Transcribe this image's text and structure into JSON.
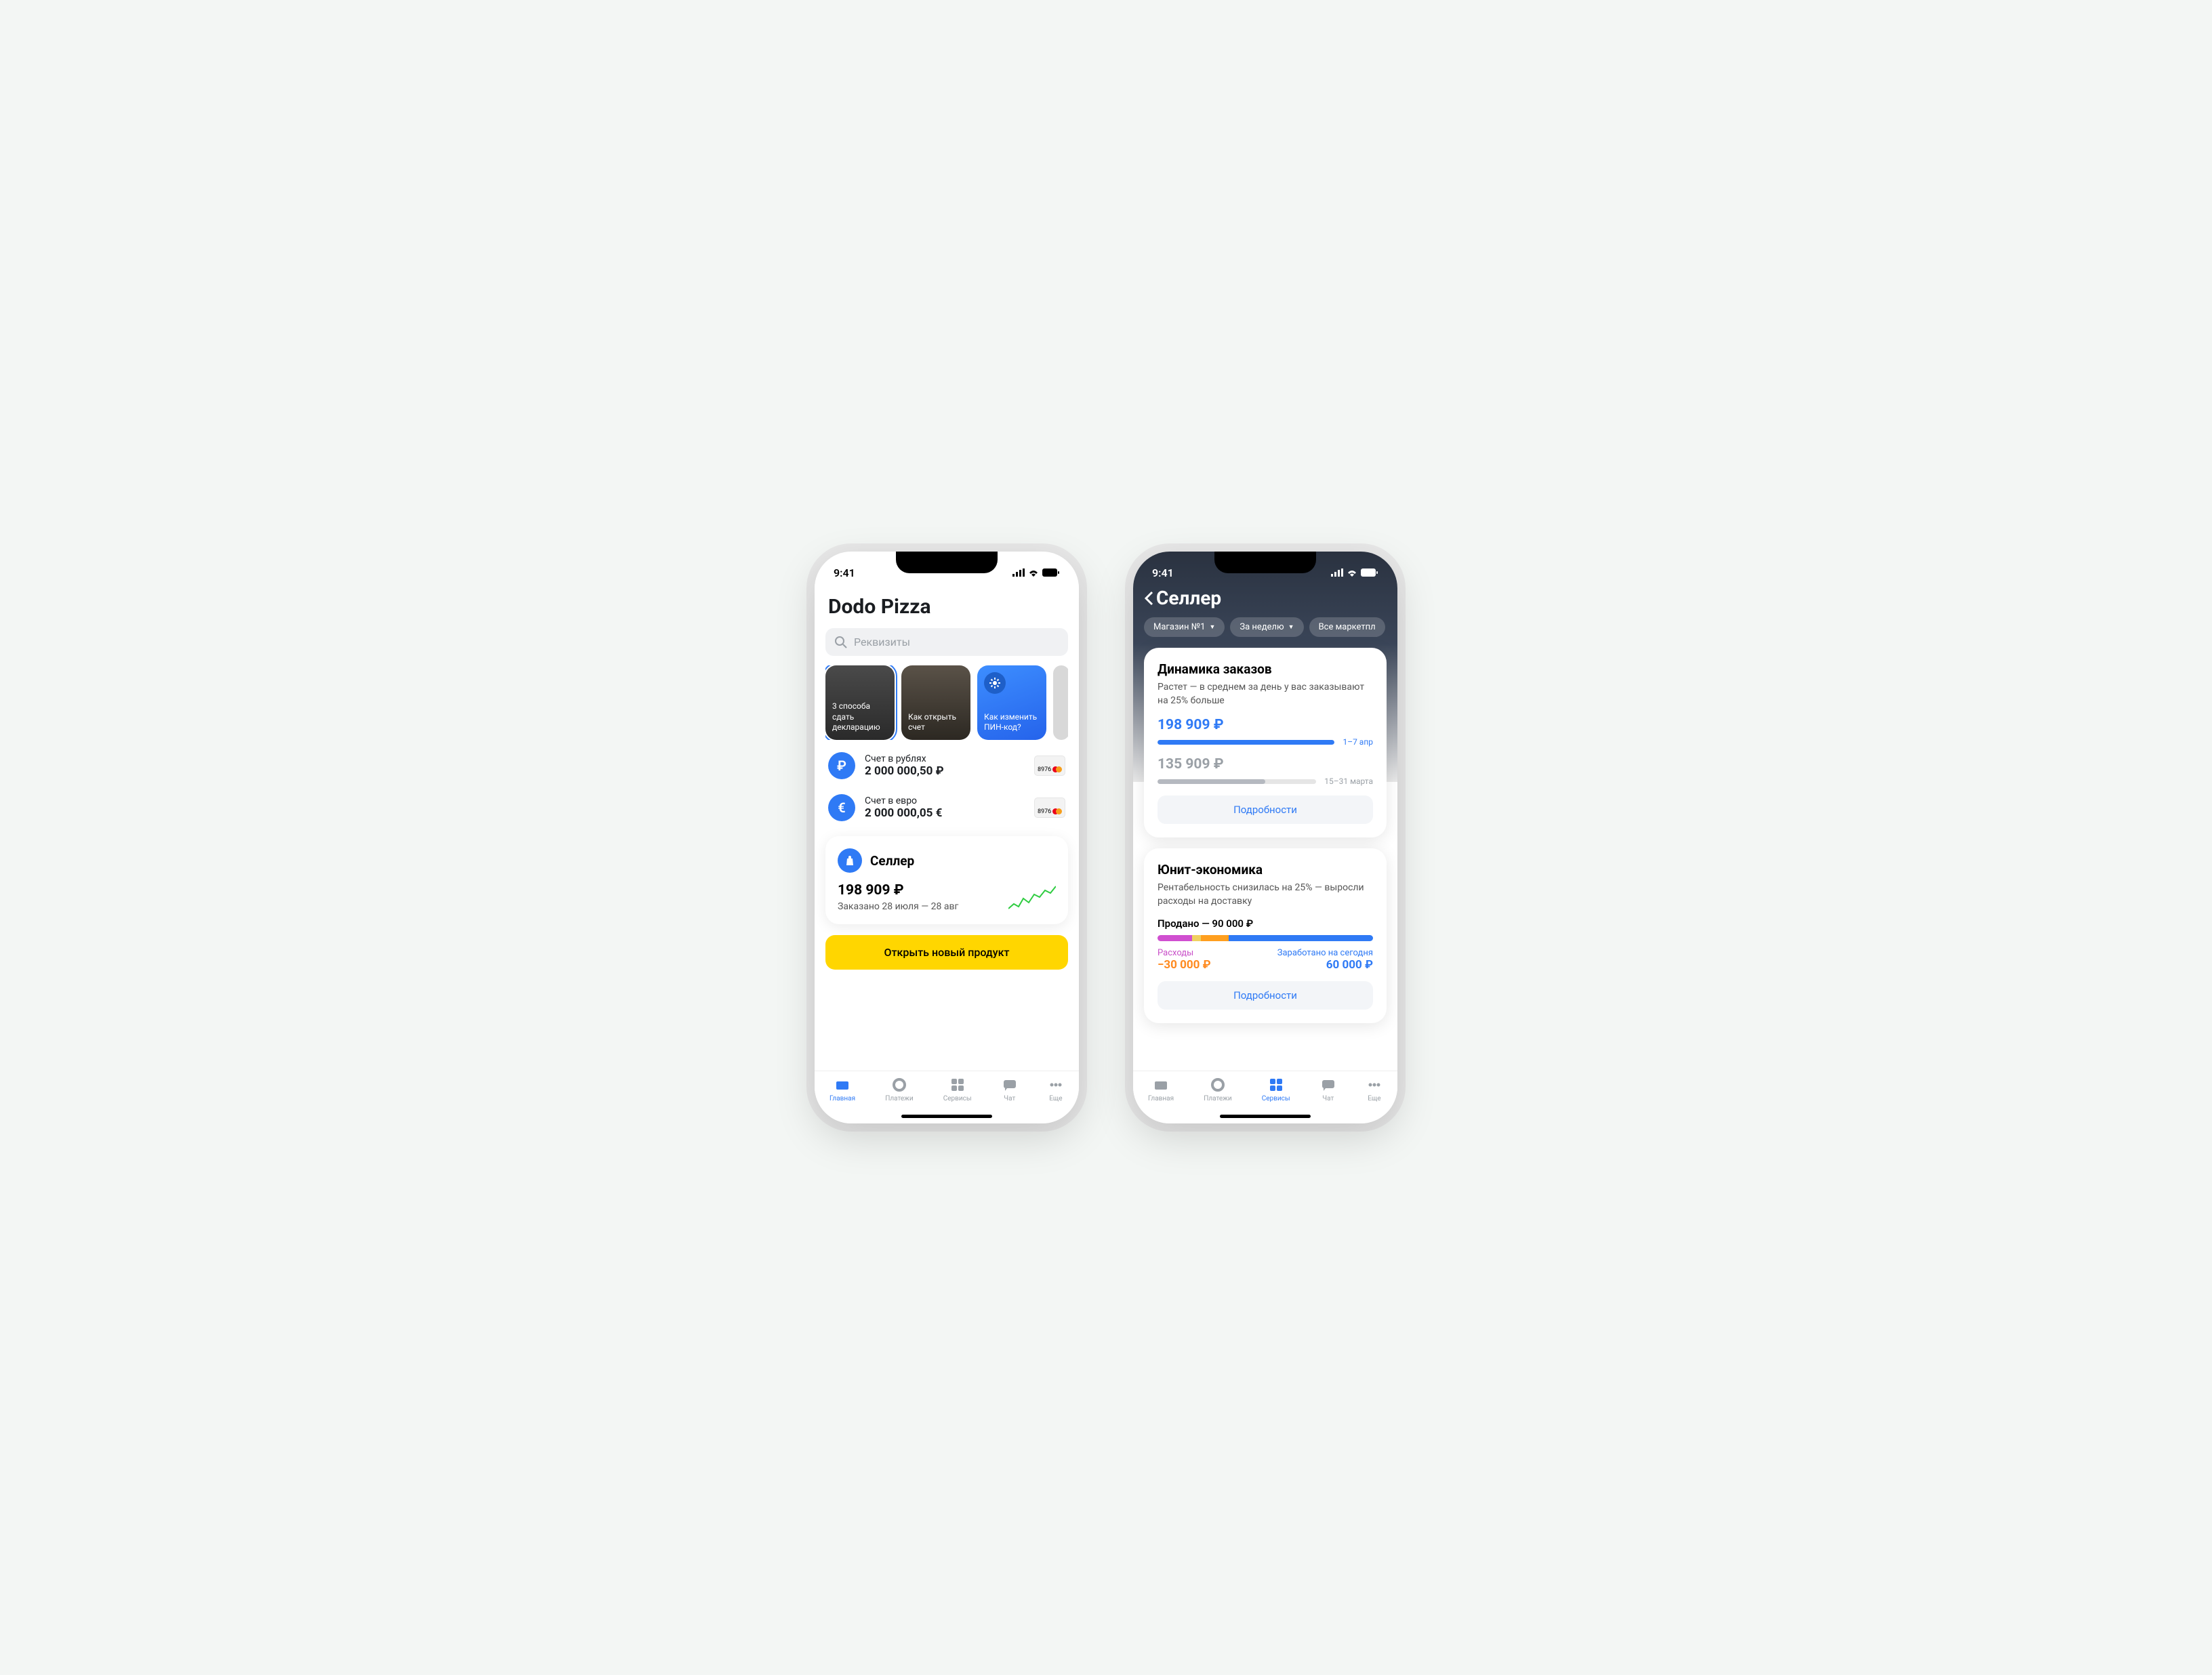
{
  "status": {
    "time": "9:41"
  },
  "phone1": {
    "title": "Dodo Pizza",
    "search_placeholder": "Реквизиты",
    "stories": [
      {
        "text": "3 способа сдать декларацию"
      },
      {
        "text": "Как открыть счет"
      },
      {
        "text": "Как изменить ПИН-код?"
      }
    ],
    "accounts": [
      {
        "label": "Счет в рублях",
        "balance": "2 000 000,50 ₽",
        "card_last4": "8976",
        "symbol": "₽"
      },
      {
        "label": "Счет в евро",
        "balance": "2 000 000,05 €",
        "card_last4": "8976",
        "symbol": "€"
      }
    ],
    "seller": {
      "title": "Селлер",
      "amount": "198 909 ₽",
      "subtitle": "Заказано 28 июля — 28 авг"
    },
    "open_button": "Открыть новый продукт"
  },
  "phone2": {
    "title": "Селлер",
    "chips": [
      "Магазин №1",
      "За неделю",
      "Все маркетпл"
    ],
    "orders": {
      "title": "Динамика заказов",
      "desc": "Растет — в среднем за день у вас заказывают на 25% больше",
      "current_val": "198 909 ₽",
      "current_period": "1–7 апр",
      "prev_val": "135 909 ₽",
      "prev_period": "15–31 марта",
      "details": "Подробности"
    },
    "unit": {
      "title": "Юнит-экономика",
      "desc": "Рентабельность снизилась на 25% — выросли расходы на доставку",
      "sold_label": "Продано — 90 000 ₽",
      "expenses_label": "Расходы",
      "expenses_val": "−30 000 ₽",
      "earned_label": "Заработано на сегодня",
      "earned_val": "60 000 ₽",
      "details": "Подробности"
    }
  },
  "tabs": {
    "home": "Главная",
    "payments": "Платежи",
    "services": "Сервисы",
    "chat": "Чат",
    "more": "Еще"
  },
  "chart_data": [
    {
      "type": "bar",
      "title": "Динамика заказов",
      "categories": [
        "15–31 марта",
        "1–7 апр"
      ],
      "values": [
        135909,
        198909
      ],
      "ylabel": "₽"
    },
    {
      "type": "bar",
      "title": "Юнит-экономика",
      "categories": [
        "Расходы",
        "Заработано"
      ],
      "values": [
        -30000,
        60000
      ],
      "total_sold": 90000,
      "ylabel": "₽"
    }
  ]
}
